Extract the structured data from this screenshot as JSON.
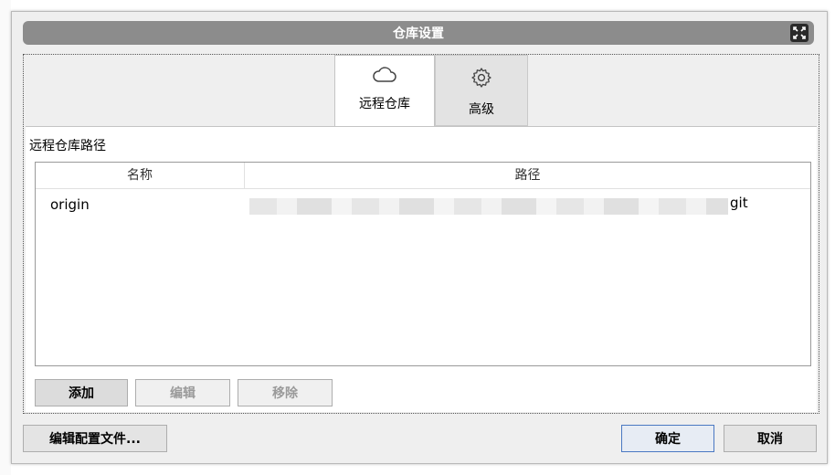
{
  "dialog": {
    "title": "仓库设置"
  },
  "tabs": [
    {
      "label": "远程仓库",
      "icon": "cloud-icon",
      "active": true
    },
    {
      "label": "高级",
      "icon": "gear-icon",
      "active": false
    }
  ],
  "remotes": {
    "section_label": "远程仓库路径",
    "columns": [
      "名称",
      "路径"
    ],
    "rows": [
      {
        "name": "origin",
        "path_visible_suffix": "git"
      }
    ]
  },
  "buttons": {
    "add": "添加",
    "edit": "编辑",
    "remove": "移除",
    "edit_config": "编辑配置文件...",
    "ok": "确定",
    "cancel": "取消"
  }
}
